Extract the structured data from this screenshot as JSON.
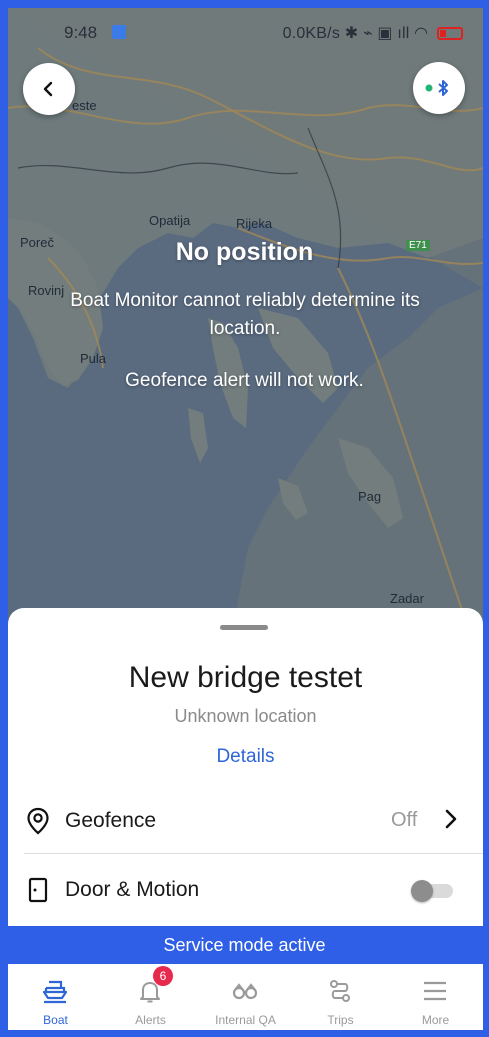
{
  "status_bar": {
    "time": "9:48",
    "right_text": "0.0KB/s",
    "battery": "14"
  },
  "map": {
    "labels": [
      "este",
      "Opatija",
      "Rijeka",
      "Poreč",
      "Rovinj",
      "Pula",
      "Pag",
      "Zadar",
      "E71"
    ]
  },
  "message": {
    "title": "No position",
    "body": "Boat Monitor cannot reliably determine its location.",
    "geofence_note": "Geofence alert will not work."
  },
  "sheet": {
    "boat_name": "New bridge testet",
    "location": "Unknown location",
    "details_link": "Details",
    "geofence": {
      "label": "Geofence",
      "value": "Off"
    },
    "door_motion": {
      "label": "Door & Motion",
      "enabled": false
    }
  },
  "service_banner": "Service mode active",
  "nav": {
    "items": [
      {
        "label": "Boat",
        "icon": "boat-icon",
        "active": true
      },
      {
        "label": "Alerts",
        "icon": "bell-icon",
        "badge": "6"
      },
      {
        "label": "Internal QA",
        "icon": "binoculars-icon"
      },
      {
        "label": "Trips",
        "icon": "route-icon"
      },
      {
        "label": "More",
        "icon": "menu-icon"
      }
    ]
  },
  "colors": {
    "accent": "#2f5fe6",
    "link": "#2f66d6",
    "badge": "#e8294e",
    "bluetooth_dot": "#22b573"
  }
}
